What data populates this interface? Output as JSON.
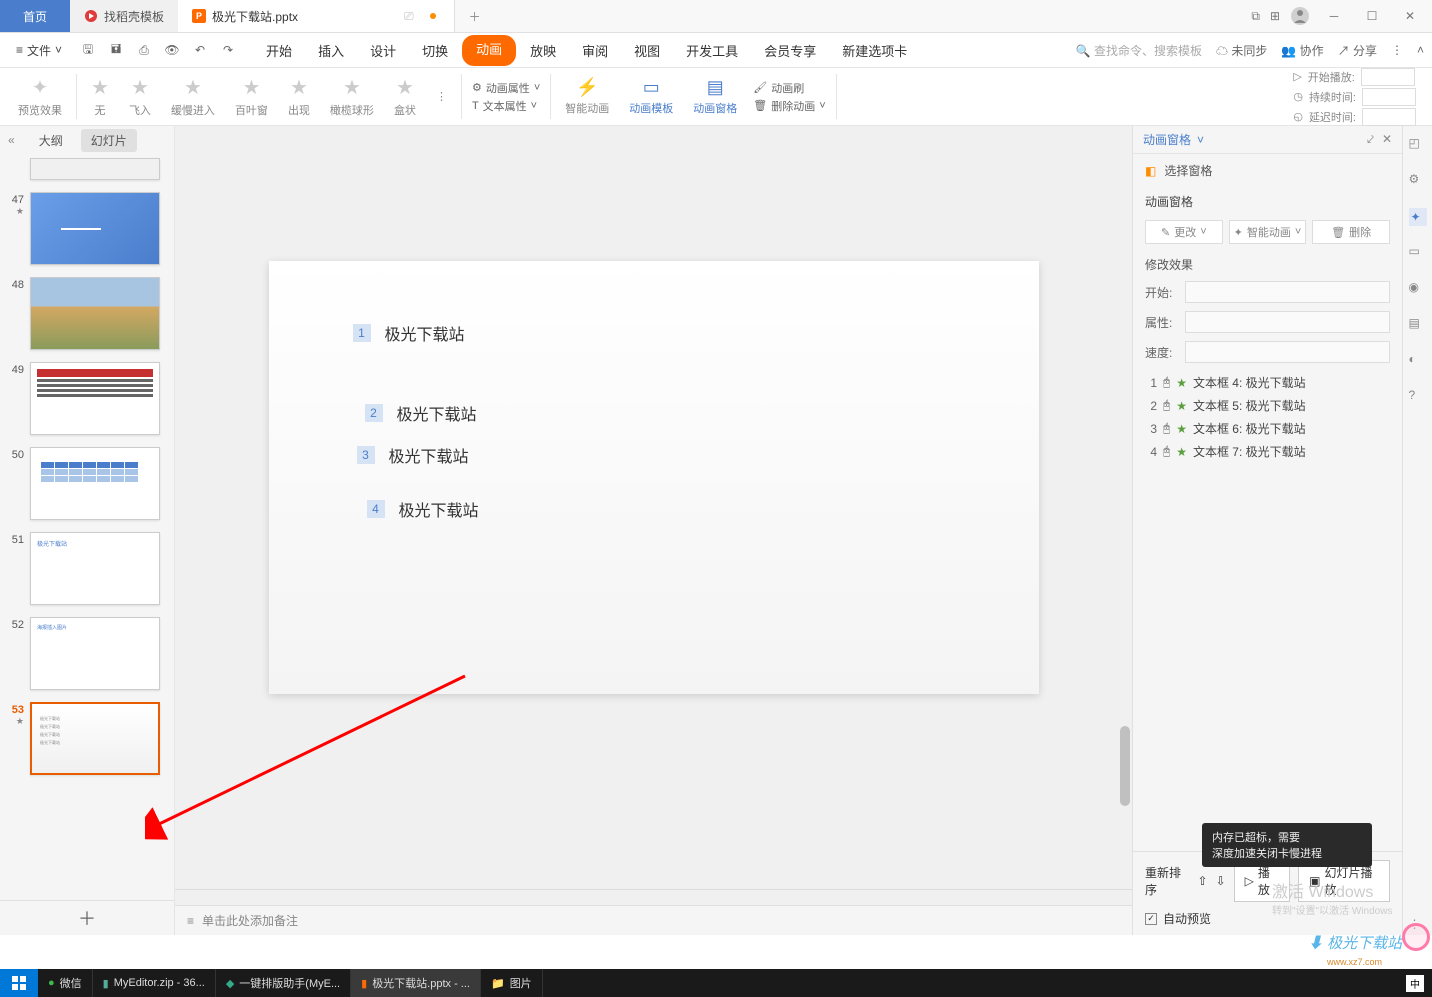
{
  "titlebar": {
    "home": "首页",
    "template": "找稻壳模板",
    "doc": "极光下载站.pptx"
  },
  "menu": {
    "file": "文件",
    "tabs": [
      "开始",
      "插入",
      "设计",
      "切换",
      "动画",
      "放映",
      "审阅",
      "视图",
      "开发工具",
      "会员专享",
      "新建选项卡"
    ],
    "active": "动画",
    "search": "查找命令、搜索模板",
    "unsync": "未同步",
    "coop": "协作",
    "share": "分享"
  },
  "ribbon": {
    "preview": "预览效果",
    "none": "无",
    "flyin": "飞入",
    "slowin": "缓慢进入",
    "blinds": "百叶窗",
    "appear": "出现",
    "olive": "橄榄球形",
    "box": "盒状",
    "anim_attr": "动画属性",
    "text_attr": "文本属性",
    "smart": "智能动画",
    "template": "动画模板",
    "pane": "动画窗格",
    "brush": "动画刷",
    "del": "删除动画",
    "start": "开始播放:",
    "dur": "持续时间:",
    "delay": "延迟时间:"
  },
  "sidebar": {
    "outline": "大纲",
    "slides": "幻灯片",
    "nums": [
      "47",
      "48",
      "49",
      "50",
      "51",
      "52",
      "53"
    ],
    "t51": "极光下载站",
    "t52": "海报插入图片"
  },
  "slide": {
    "items": [
      {
        "n": "1",
        "t": "极光下载站"
      },
      {
        "n": "2",
        "t": "极光下载站"
      },
      {
        "n": "3",
        "t": "极光下载站"
      },
      {
        "n": "4",
        "t": "极光下载站"
      }
    ]
  },
  "notes": "单击此处添加备注",
  "rightpane": {
    "title": "动画窗格",
    "select": "选择窗格",
    "pane_t": "动画窗格",
    "modify_btn": "更改",
    "smart_btn": "智能动画",
    "del_btn": "删除",
    "effect": "修改效果",
    "start_lbl": "开始:",
    "attr_lbl": "属性:",
    "speed_lbl": "速度:",
    "items": [
      {
        "n": "1",
        "t": "文本框 4: 极光下载站"
      },
      {
        "n": "2",
        "t": "文本框 5: 极光下载站"
      },
      {
        "n": "3",
        "t": "文本框 6: 极光下载站"
      },
      {
        "n": "4",
        "t": "文本框 7: 极光下载站"
      }
    ],
    "reorder": "重新排序",
    "play": "播放",
    "slideshow": "幻灯片播放",
    "auto": "自动预览"
  },
  "watermark": {
    "title": "激活 Windows",
    "sub": "转到\"设置\"以激活 Windows",
    "tip1": "内存已超标，需要",
    "tip2": "深度加速关闭卡慢进程"
  },
  "logo": {
    "t": "极光下载站",
    "url": "www.xz7.com"
  },
  "taskbar": {
    "wechat": "微信",
    "myeditor": "MyEditor.zip - 36...",
    "typeset": "一键排版助手(MyE...",
    "ppt": "极光下载站.pptx - ...",
    "pic": "图片",
    "lang": "中"
  }
}
